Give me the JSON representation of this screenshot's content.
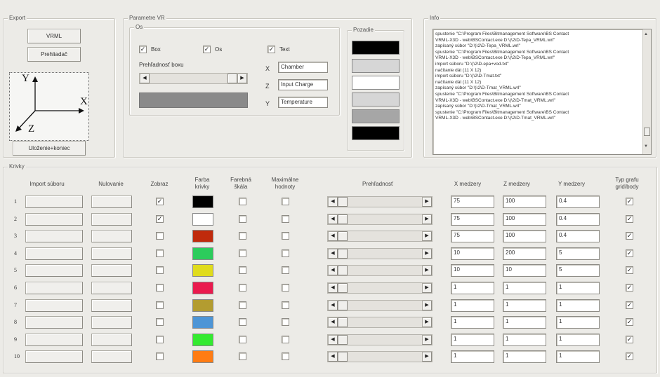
{
  "export": {
    "title": "Export",
    "vrml_button": "VRML",
    "browser_button": "Prehliadač",
    "axes_labels": {
      "y": "Y",
      "x": "X",
      "z": "Z"
    },
    "save_exit_button": "Uloženie+koniec"
  },
  "params": {
    "title": "Parametre VR",
    "axes_group": {
      "title": "Os",
      "box_label": "Box",
      "axis_label": "Os",
      "text_label": "Text",
      "box_checked": true,
      "axis_checked": true,
      "text_checked": true
    },
    "box_transparency_label": "Prehľadnosť boxu",
    "x_label": "X",
    "z_label": "Z",
    "y_label": "Y",
    "x_value": "Chamber",
    "z_value": "Input Charge",
    "y_value": "Temperature",
    "background_group": {
      "title": "Pozadie",
      "colors": [
        "#000000",
        "#d6d6d6",
        "#ffffff",
        "#d6d6d6",
        "#a6a6a6",
        "#000000"
      ]
    },
    "color_preview": "#8a8a8a"
  },
  "info": {
    "title": "Info",
    "log": [
      "spustenie \"C:\\Program Files\\Bitmanagement Software\\BS Contact",
      "VRML-X3D - web\\BSContact.exe D:\\)\\2\\D-Tepa_VRML.wrl\"",
      "zapísaný súbor \"D:\\)\\2\\D-Tepa_VRML.wrl\"",
      "spustenie \"C:\\Program Files\\Bitmanagement Software\\BS Contact",
      "VRML-X3D - web\\BSContact.exe D:\\)\\2\\D-Tepa_VRML.wrl\"",
      "import súboru \"D:\\)\\2\\D-epa+vod.txt\"",
      "načítanie dát (11 X 12)",
      "import súboru \"D:\\)\\2\\D-Tmat.txt\"",
      "načítanie dát (11 X 12)",
      "zapísaný súbor \"D:\\)\\2\\D-Tmat_VRML.wrl\"",
      "spustenie \"C:\\Program Files\\Bitmanagement Software\\BS Contact",
      "VRML-X3D - web\\BSContact.exe D:\\)\\2\\D-Tmat_VRML.wrl\"",
      "zapísaný súbor \"D:\\)\\2\\D-Tmat_VRML.wrl\"",
      "spustenie \"C:\\Program Files\\Bitmanagement Software\\BS Contact",
      "VRML-X3D - web\\BSContact.exe D:\\)\\2\\D-Tmat_VRML.wrl\""
    ]
  },
  "curves": {
    "title": "Krivky",
    "headers": {
      "import": "Import súboru",
      "reset": "Nulovanie",
      "show": "Zobraz",
      "color": "Farba krivky",
      "colorscale": "Farebná škála",
      "max": "Maximálne hodnoty",
      "transparency": "Prehľadnosť",
      "xgap": "X medzery",
      "zgap": "Z medzery",
      "ygap": "Y medzery",
      "type": "Typ grafu grid/body"
    },
    "rows": [
      {
        "num": "1",
        "show": true,
        "color": "#000000",
        "x": "75",
        "z": "100",
        "y": "0.4",
        "type": true
      },
      {
        "num": "2",
        "show": true,
        "color": "#ffffff",
        "x": "75",
        "z": "100",
        "y": "0.4",
        "type": true
      },
      {
        "num": "3",
        "show": false,
        "color": "#c02a0c",
        "x": "75",
        "z": "100",
        "y": "0.4",
        "type": true
      },
      {
        "num": "4",
        "show": false,
        "color": "#2ccc5c",
        "x": "10",
        "z": "200",
        "y": "5",
        "type": true
      },
      {
        "num": "5",
        "show": false,
        "color": "#e0dc1c",
        "x": "10",
        "z": "10",
        "y": "5",
        "type": true
      },
      {
        "num": "6",
        "show": false,
        "color": "#ea1a4e",
        "x": "1",
        "z": "1",
        "y": "1",
        "type": true
      },
      {
        "num": "7",
        "show": false,
        "color": "#b39c30",
        "x": "1",
        "z": "1",
        "y": "1",
        "type": true
      },
      {
        "num": "8",
        "show": false,
        "color": "#4d95d6",
        "x": "1",
        "z": "1",
        "y": "1",
        "type": true
      },
      {
        "num": "9",
        "show": false,
        "color": "#34ea30",
        "x": "1",
        "z": "1",
        "y": "1",
        "type": true
      },
      {
        "num": "10",
        "show": false,
        "color": "#ff7c14",
        "x": "1",
        "z": "1",
        "y": "1",
        "type": true
      }
    ]
  }
}
